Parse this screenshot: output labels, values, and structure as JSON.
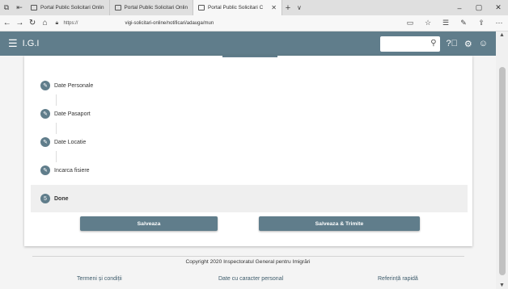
{
  "browser": {
    "tabs": [
      {
        "label": "Portal Public Solicitari Onlin"
      },
      {
        "label": "Portal Public Solicitari Onlin"
      },
      {
        "label": "Portal Public Solicitari C"
      }
    ],
    "new_tab": "+",
    "tab_menu": "∨",
    "window_controls": {
      "minimize": "–",
      "maximize": "▢",
      "close": "✕"
    },
    "url_scheme": "https://",
    "url_path": "vigi-solicitari-online/notificari/adauga/mun"
  },
  "app": {
    "brand": "I.G.I",
    "search": {
      "placeholder": "",
      "value": ""
    }
  },
  "steps": [
    {
      "number": "",
      "label": "Date Personale",
      "state": "done"
    },
    {
      "number": "",
      "label": "Date Pasaport",
      "state": "done"
    },
    {
      "number": "",
      "label": "Date Locatie",
      "state": "done"
    },
    {
      "number": "",
      "label": "Incarca fisiere",
      "state": "done"
    },
    {
      "number": "5",
      "label": "Done",
      "state": "active"
    }
  ],
  "buttons": {
    "save": "Salveaza",
    "save_send": "Salveaza & Trimite"
  },
  "footer": {
    "copyright": "Copyright 2020 Inspectoratul General pentru Imigrări",
    "links": [
      "Termeni și condiții",
      "Date cu caracter personal",
      "Referință rapidă"
    ]
  },
  "colors": {
    "accent": "#607d8b",
    "background": "#f4f4f4"
  }
}
